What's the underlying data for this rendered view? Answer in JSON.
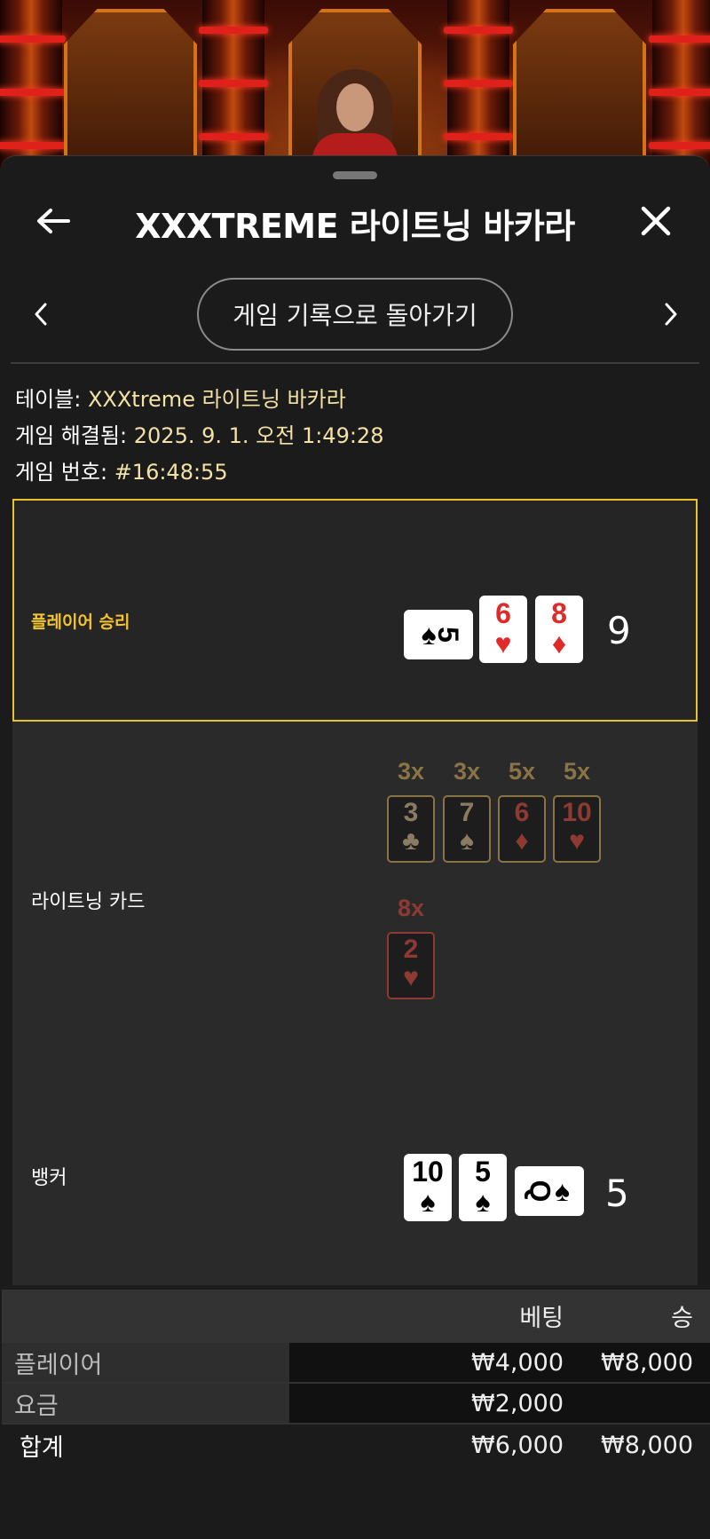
{
  "header": {
    "title": "XXXTREME 라이트닝 바카라",
    "back_label": "←",
    "close_label": "✕"
  },
  "nav": {
    "prev_label": "‹",
    "next_label": "›",
    "back_to_history": "게임 기록으로 돌아가기"
  },
  "info": {
    "table_label": "테이블:",
    "table_value": "XXXtreme 라이트닝 바카라",
    "resolved_label": "게임 해결됨:",
    "resolved_value": "2025. 9. 1. 오전 1:49:28",
    "number_label": "게임 번호:",
    "number_value": "#16:48:55"
  },
  "result": {
    "player_label": "플레이어 승리",
    "player_score": "9",
    "player_cards": [
      {
        "rank": "5",
        "suit": "♠",
        "color": "black",
        "rotated": true
      },
      {
        "rank": "6",
        "suit": "♥",
        "color": "red"
      },
      {
        "rank": "8",
        "suit": "♦",
        "color": "red"
      }
    ],
    "lightning_label": "라이트닝 카드",
    "lightning_cards": [
      {
        "mult": "3x",
        "rank": "3",
        "suit": "♣"
      },
      {
        "mult": "3x",
        "rank": "7",
        "suit": "♠"
      },
      {
        "mult": "5x",
        "rank": "6",
        "suit": "♦"
      },
      {
        "mult": "5x",
        "rank": "10",
        "suit": "♥"
      },
      {
        "mult": "8x",
        "rank": "2",
        "suit": "♥"
      }
    ],
    "banker_label": "뱅커",
    "banker_score": "5",
    "banker_cards": [
      {
        "rank": "10",
        "suit": "♠",
        "color": "black"
      },
      {
        "rank": "5",
        "suit": "♠",
        "color": "black"
      },
      {
        "rank": "Q",
        "suit": "♠",
        "color": "black",
        "rotated": true
      }
    ]
  },
  "bets": {
    "headers": {
      "bet": "베팅",
      "win": "승"
    },
    "rows": [
      {
        "name": "플레이어",
        "bet": "₩4,000",
        "win": "₩8,000"
      },
      {
        "name": "요금",
        "bet": "₩2,000",
        "win": ""
      }
    ],
    "total": {
      "name": "합계",
      "bet": "₩6,000",
      "win": "₩8,000"
    }
  },
  "colors": {
    "accent_gold": "#e9c12b",
    "info_value": "#f3e2a6",
    "card_red": "#e02a2a"
  },
  "icons": {
    "back": "arrow-left-icon",
    "close": "close-icon",
    "prev": "chevron-left-icon",
    "next": "chevron-right-icon"
  }
}
